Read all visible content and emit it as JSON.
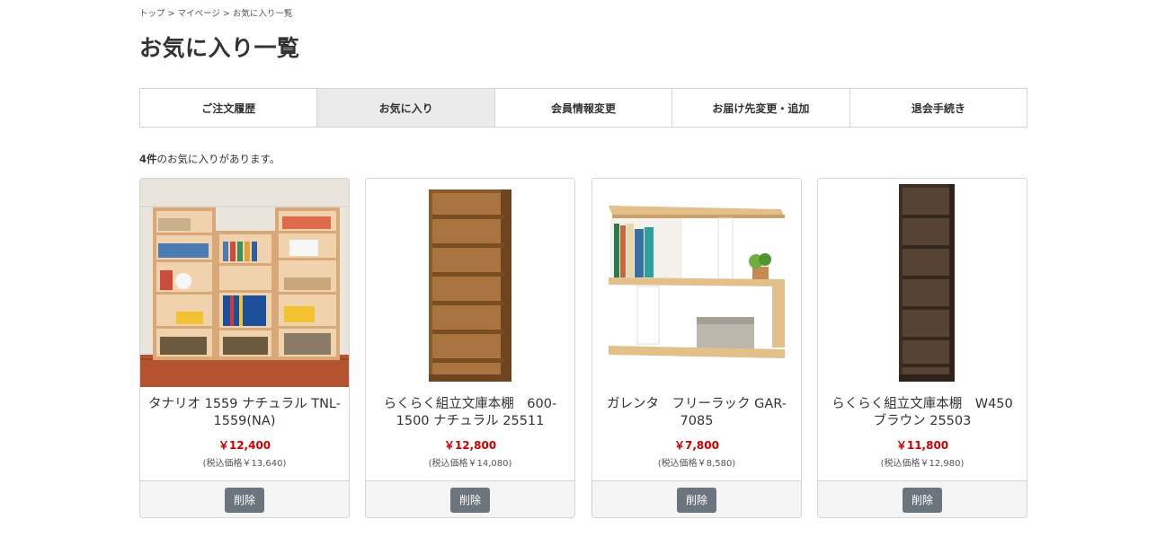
{
  "breadcrumb": {
    "top": "トップ",
    "mypage": "マイページ",
    "current": "お気に入り一覧",
    "separator": ">"
  },
  "page_title": "お気に入り一覧",
  "tabs": [
    {
      "label": "ご注文履歴",
      "active": false
    },
    {
      "label": "お気に入り",
      "active": true
    },
    {
      "label": "会員情報変更",
      "active": false
    },
    {
      "label": "お届け先変更・追加",
      "active": false
    },
    {
      "label": "退会手続き",
      "active": false
    }
  ],
  "count": {
    "number": "4件",
    "text": "のお気に入りがあります。"
  },
  "products": [
    {
      "name": "タナリオ 1559 ナチュラル TNL-1559(NA)",
      "price": "￥12,400",
      "tax_price": "(税込価格￥13,640)",
      "delete_label": "削除",
      "image": "natural-bookshelf-set-photo"
    },
    {
      "name": "らくらく組立文庫本棚　600-1500 ナチュラル 25511",
      "price": "￥12,800",
      "tax_price": "(税込価格￥14,080)",
      "delete_label": "削除",
      "image": "oak-bookshelf-photo"
    },
    {
      "name": "ガレンタ　フリーラック GAR-7085",
      "price": "￥7,800",
      "tax_price": "(税込価格￥8,580)",
      "delete_label": "削除",
      "image": "open-rack-photo"
    },
    {
      "name": "らくらく組立文庫本棚　W450 ブラウン 25503",
      "price": "￥11,800",
      "tax_price": "(税込価格￥12,980)",
      "delete_label": "削除",
      "image": "brown-bookshelf-photo"
    }
  ],
  "colors": {
    "price": "#cc0000",
    "button": "#6c757d",
    "active_tab": "#ebebeb",
    "border": "#d4d4d4"
  }
}
